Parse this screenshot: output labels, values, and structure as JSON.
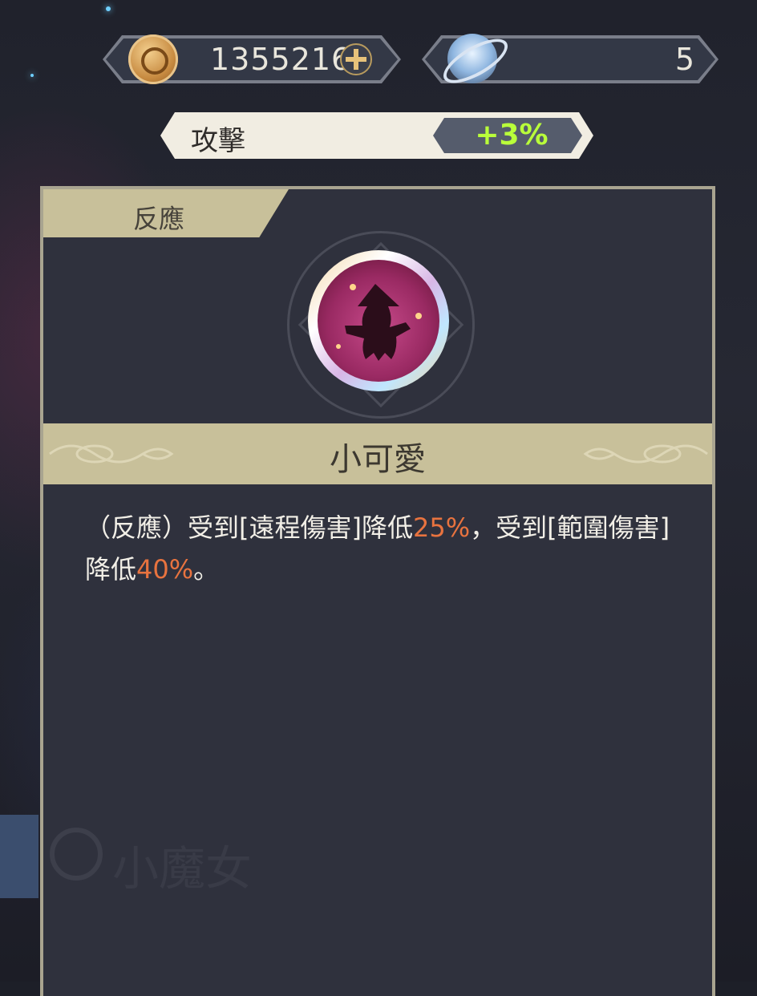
{
  "currency": {
    "gold_amount": "1355216",
    "gold_icon": "gold-coin-icon",
    "add_icon": "plus-icon",
    "gem_amount": "5",
    "gem_icon": "orb-icon"
  },
  "stat": {
    "label": "攻擊",
    "value": "+3%",
    "value_color": "#b9ff3a"
  },
  "panel": {
    "tab_label": "反應",
    "skill_icon": "witch-silhouette-icon",
    "skill_name": "小可愛",
    "description": {
      "part1": "（反應）受到[遠程傷害]降低",
      "value1": "25%",
      "part2": "，受到[範圍傷害]降低",
      "value2": "40%",
      "part3": "。"
    },
    "highlight_color": "#e8733f",
    "watermark_text": "小魔女"
  }
}
